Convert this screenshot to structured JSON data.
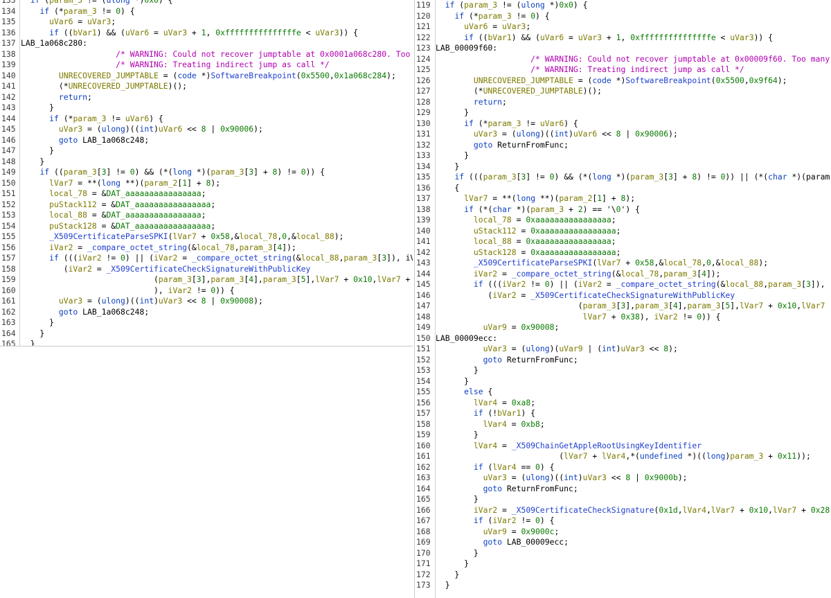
{
  "left_pane": {
    "lines": [
      {
        "n": "133",
        "t": "  if (param_3 != (ulong *)0x0) {"
      },
      {
        "n": "134",
        "t": "    if (*param_3 != 0) {"
      },
      {
        "n": "135",
        "t": "      uVar6 = uVar3;"
      },
      {
        "n": "136",
        "t": "      if ((bVar1) && (uVar6 = uVar3 + 1, 0xfffffffffffffffe < uVar3)) {"
      },
      {
        "n": "137",
        "t": "LAB_1a068c280:"
      },
      {
        "n": "138",
        "t": "                    /* WARNING: Could not recover jumptable at 0x0001a068c280. Too"
      },
      {
        "n": "139",
        "t": "                    /* WARNING: Treating indirect jump as call */"
      },
      {
        "n": "140",
        "t": "        UNRECOVERED_JUMPTABLE = (code *)SoftwareBreakpoint(0x5500,0x1a068c284);"
      },
      {
        "n": "141",
        "t": "        (*UNRECOVERED_JUMPTABLE)();"
      },
      {
        "n": "142",
        "t": "        return;"
      },
      {
        "n": "143",
        "t": "      }"
      },
      {
        "n": "144",
        "t": "      if (*param_3 != uVar6) {"
      },
      {
        "n": "145",
        "t": "        uVar3 = (ulong)((int)uVar6 << 8 | 0x90006);"
      },
      {
        "n": "146",
        "t": "        goto LAB_1a068c248;"
      },
      {
        "n": "147",
        "t": "      }"
      },
      {
        "n": "148",
        "t": "    }"
      },
      {
        "n": "149",
        "t": "    if ((param_3[3] != 0) && (*(long *)(param_3[3] + 8) != 0)) {"
      },
      {
        "n": "150",
        "t": "      lVar7 = **(long **)(param_2[1] + 8);"
      },
      {
        "n": "151",
        "t": "      local_78 = &DAT_aaaaaaaaaaaaaaaa;"
      },
      {
        "n": "152",
        "t": "      puStack112 = &DAT_aaaaaaaaaaaaaaaa;"
      },
      {
        "n": "153",
        "t": "      local_88 = &DAT_aaaaaaaaaaaaaaaa;"
      },
      {
        "n": "154",
        "t": "      puStack128 = &DAT_aaaaaaaaaaaaaaaa;"
      },
      {
        "n": "155",
        "t": "      _X509CertificateParseSPKI(lVar7 + 0x58,&local_78,0,&local_88);"
      },
      {
        "n": "156",
        "t": "      iVar2 = _compare_octet_string(&local_78,param_3[4]);"
      },
      {
        "n": "157",
        "t": "      if (((iVar2 != 0) || (iVar2 = _compare_octet_string(&local_88,param_3[3]), iV"
      },
      {
        "n": "158",
        "t": "         (iVar2 = _X509CertificateCheckSignatureWithPublicKey"
      },
      {
        "n": "159",
        "t": "                            (param_3[3],param_3[4],param_3[5],lVar7 + 0x10,lVar7 +"
      },
      {
        "n": "160",
        "t": "                            ), iVar2 != 0)) {"
      },
      {
        "n": "161",
        "t": "        uVar3 = (ulong)((int)uVar3 << 8 | 0x90008);"
      },
      {
        "n": "162",
        "t": "        goto LAB_1a068c248;"
      },
      {
        "n": "163",
        "t": "      }"
      },
      {
        "n": "164",
        "t": "    }"
      },
      {
        "n": "165",
        "t": "  }"
      }
    ]
  },
  "right_pane": {
    "lines": [
      {
        "n": "119",
        "t": "  if (param_3 != (ulong *)0x0) {"
      },
      {
        "n": "120",
        "t": "    if (*param_3 != 0) {"
      },
      {
        "n": "121",
        "t": "      uVar6 = uVar3;"
      },
      {
        "n": "122",
        "t": "      if ((bVar1) && (uVar6 = uVar3 + 1, 0xfffffffffffffffe < uVar3)) {"
      },
      {
        "n": "123",
        "t": "LAB_00009f60:"
      },
      {
        "n": "124",
        "t": "                    /* WARNING: Could not recover jumptable at 0x00009f60. Too many"
      },
      {
        "n": "125",
        "t": "                    /* WARNING: Treating indirect jump as call */"
      },
      {
        "n": "126",
        "t": "        UNRECOVERED_JUMPTABLE = (code *)SoftwareBreakpoint(0x5500,0x9f64);"
      },
      {
        "n": "127",
        "t": "        (*UNRECOVERED_JUMPTABLE)();"
      },
      {
        "n": "128",
        "t": "        return;"
      },
      {
        "n": "129",
        "t": "      }"
      },
      {
        "n": "130",
        "t": "      if (*param_3 != uVar6) {"
      },
      {
        "n": "131",
        "t": "        uVar3 = (ulong)((int)uVar6 << 8 | 0x90006);"
      },
      {
        "n": "132",
        "t": "        goto ReturnFromFunc;"
      },
      {
        "n": "133",
        "t": "      }"
      },
      {
        "n": "134",
        "t": "    }"
      },
      {
        "n": "135",
        "t": "    if (((param_3[3] != 0) && (*(long *)(param_3[3] + 8) != 0)) || (*(char *)(param"
      },
      {
        "n": "136",
        "t": "    {"
      },
      {
        "n": "137",
        "t": "      lVar7 = **(long **)(param_2[1] + 8);"
      },
      {
        "n": "138",
        "t": "      if (*(char *)(param_3 + 2) == '\\0') {"
      },
      {
        "n": "139",
        "t": "        local_78 = 0xaaaaaaaaaaaaaaaa;"
      },
      {
        "n": "140",
        "t": "        uStack112 = 0xaaaaaaaaaaaaaaaa;"
      },
      {
        "n": "141",
        "t": "        local_88 = 0xaaaaaaaaaaaaaaaa;"
      },
      {
        "n": "142",
        "t": "        uStack128 = 0xaaaaaaaaaaaaaaaa;"
      },
      {
        "n": "143",
        "t": "        _X509CertificateParseSPKI(lVar7 + 0x58,&local_78,0,&local_88);"
      },
      {
        "n": "144",
        "t": "        iVar2 = _compare_octet_string(&local_78,param_3[4]);"
      },
      {
        "n": "145",
        "t": "        if (((iVar2 != 0) || (iVar2 = _compare_octet_string(&local_88,param_3[3]),"
      },
      {
        "n": "146",
        "t": "           (iVar2 = _X509CertificateCheckSignatureWithPublicKey"
      },
      {
        "n": "147",
        "t": "                              (param_3[3],param_3[4],param_3[5],lVar7 + 0x10,lVar7"
      },
      {
        "n": "148",
        "t": "                               lVar7 + 0x38), iVar2 != 0)) {"
      },
      {
        "n": "149",
        "t": "          uVar9 = 0x90008;"
      },
      {
        "n": "150",
        "t": "LAB_00009ecc:"
      },
      {
        "n": "151",
        "t": "          uVar3 = (ulong)(uVar9 | (int)uVar3 << 8);"
      },
      {
        "n": "152",
        "t": "          goto ReturnFromFunc;"
      },
      {
        "n": "153",
        "t": "        }"
      },
      {
        "n": "154",
        "t": "      }"
      },
      {
        "n": "155",
        "t": "      else {"
      },
      {
        "n": "156",
        "t": "        lVar4 = 0xa8;"
      },
      {
        "n": "157",
        "t": "        if (!bVar1) {"
      },
      {
        "n": "158",
        "t": "          lVar4 = 0xb8;"
      },
      {
        "n": "159",
        "t": "        }"
      },
      {
        "n": "160",
        "t": "        lVar4 = _X509ChainGetAppleRootUsingKeyIdentifier"
      },
      {
        "n": "161",
        "t": "                          (lVar7 + lVar4,*(undefined *)((long)param_3 + 0x11));"
      },
      {
        "n": "162",
        "t": "        if (lVar4 == 0) {"
      },
      {
        "n": "163",
        "t": "          uVar3 = (ulong)((int)uVar3 << 8 | 0x9000b);"
      },
      {
        "n": "164",
        "t": "          goto ReturnFromFunc;"
      },
      {
        "n": "165",
        "t": "        }"
      },
      {
        "n": "166",
        "t": "        iVar2 = _X509CertificateCheckSignature(0x1d,lVar4,lVar7 + 0x10,lVar7 + 0x28"
      },
      {
        "n": "167",
        "t": "        if (iVar2 != 0) {"
      },
      {
        "n": "168",
        "t": "          uVar9 = 0x9000c;"
      },
      {
        "n": "169",
        "t": "          goto LAB_00009ecc;"
      },
      {
        "n": "170",
        "t": "        }"
      },
      {
        "n": "171",
        "t": "      }"
      },
      {
        "n": "172",
        "t": "    }"
      },
      {
        "n": "173",
        "t": "  }"
      }
    ]
  }
}
